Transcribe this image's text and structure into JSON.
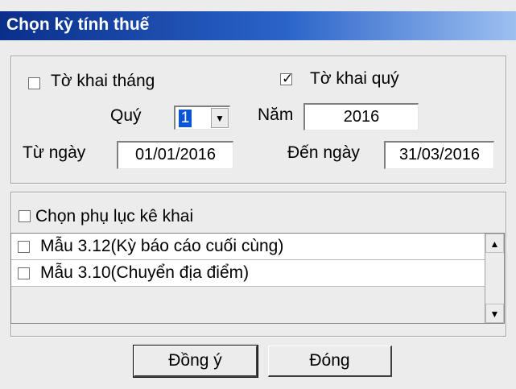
{
  "window": {
    "title": "Chọn kỳ tính thuế"
  },
  "period": {
    "monthly_label": "Tờ khai tháng",
    "monthly_checked": false,
    "quarterly_label": "Tờ khai quý",
    "quarterly_checked": true,
    "quarter_label": "Quý",
    "quarter_value": "1",
    "year_label": "Năm",
    "year_value": "2016",
    "from_label": "Từ ngày",
    "from_value": "01/01/2016",
    "to_label": "Đến ngày",
    "to_value": "31/03/2016"
  },
  "appendix": {
    "select_label": "Chọn phụ lục kê khai",
    "select_checked": false,
    "items": [
      {
        "label": "Mẫu 3.12(Kỳ báo cáo cuối cùng)",
        "checked": false
      },
      {
        "label": "Mẫu 3.10(Chuyển địa điểm)",
        "checked": false
      }
    ]
  },
  "buttons": {
    "ok": "Đồng ý",
    "close": "Đóng"
  },
  "icons": {
    "check": "check-icon",
    "dropdown": "chevron-down-icon",
    "scroll_up": "scroll-up-icon",
    "scroll_down": "scroll-down-icon"
  },
  "colors": {
    "title_start": "#0a2f8a",
    "title_end": "#9dc0f0",
    "selection": "#0a54d6"
  }
}
